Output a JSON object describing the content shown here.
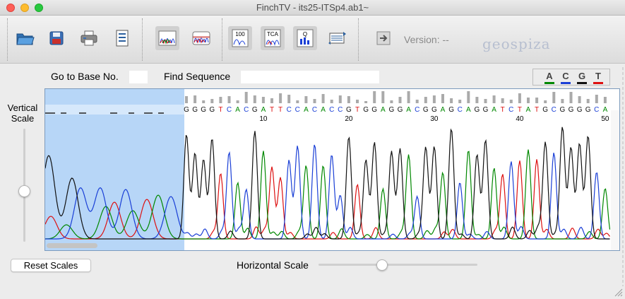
{
  "window": {
    "title": "FinchTV - its25-ITSp4.ab1~"
  },
  "toolbar": {
    "buttons": [
      {
        "icon": "open-folder-icon"
      },
      {
        "icon": "save-disk-icon"
      },
      {
        "icon": "print-icon"
      },
      {
        "icon": "info-document-icon"
      },
      {
        "icon": "chromatogram-view-icon"
      },
      {
        "icon": "chromatogram-alt-view-icon"
      },
      {
        "icon": "quality-values-icon",
        "text": "100"
      },
      {
        "icon": "sequence-text-icon",
        "text": "TCA"
      },
      {
        "icon": "quality-report-icon",
        "text": "Q"
      },
      {
        "icon": "scroll-sequence-icon"
      },
      {
        "icon": "export-icon"
      }
    ],
    "version_label": "Version: --",
    "logo_text": "geospiza"
  },
  "controls": {
    "goto_label": "Go to Base No.",
    "goto_value": "",
    "find_label": "Find Sequence",
    "find_value": ""
  },
  "legend": [
    {
      "base": "A",
      "color": "#008800"
    },
    {
      "base": "C",
      "color": "#1a3fd6"
    },
    {
      "base": "G",
      "color": "#111111"
    },
    {
      "base": "T",
      "color": "#dd1111"
    }
  ],
  "vertical_scale_label": "Vertical Scale",
  "vertical_scale_level": 0.55,
  "horizontal_scale_label": "Horizontal Scale",
  "horizontal_scale_level": 0.4,
  "reset_button_label": "Reset Scales",
  "sequence": {
    "bases": "GGGGTCACGATTCCACACCGTGGAGGACGGAGCAGGATCTATGCGGGGCA",
    "position_labels": [
      "10",
      "20",
      "30",
      "40",
      "50"
    ],
    "selected_region_label": "trimmed low-quality start"
  }
}
